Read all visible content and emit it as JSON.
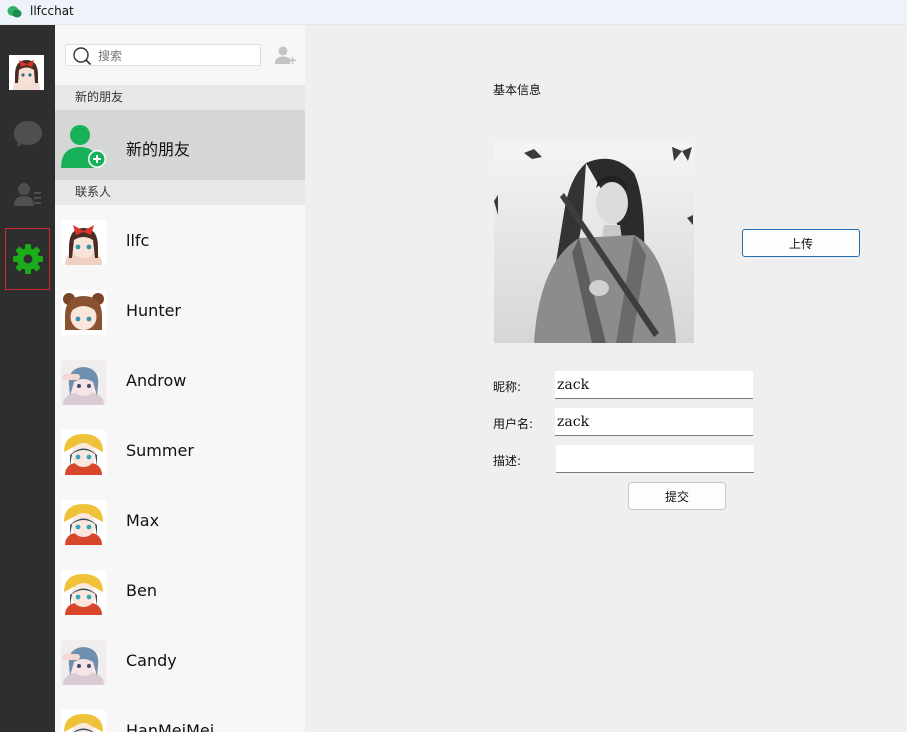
{
  "window": {
    "title": "llfcchat"
  },
  "sidebar": {
    "items": [
      {
        "name": "chat",
        "icon": "chat-bubble-icon"
      },
      {
        "name": "contacts",
        "icon": "contact-list-icon"
      },
      {
        "name": "settings",
        "icon": "gear-icon",
        "active": true
      }
    ],
    "active_color": "#1aad19"
  },
  "search": {
    "placeholder": "搜索"
  },
  "sections": {
    "new_friends_header": "新的朋友",
    "new_friends_item": "新的朋友",
    "contacts_header": "联系人"
  },
  "contacts": [
    {
      "name": "llfc"
    },
    {
      "name": "Hunter"
    },
    {
      "name": "Androw"
    },
    {
      "name": "Summer"
    },
    {
      "name": "Max"
    },
    {
      "name": "Ben"
    },
    {
      "name": "Candy"
    },
    {
      "name": "HanMeiMei"
    }
  ],
  "profile": {
    "section_title": "基本信息",
    "upload_label": "上传",
    "nickname_label": "昵称:",
    "nickname_value": "zack",
    "username_label": "用户名:",
    "username_value": "zack",
    "desc_label": "描述:",
    "desc_value": "",
    "submit_label": "提交"
  }
}
